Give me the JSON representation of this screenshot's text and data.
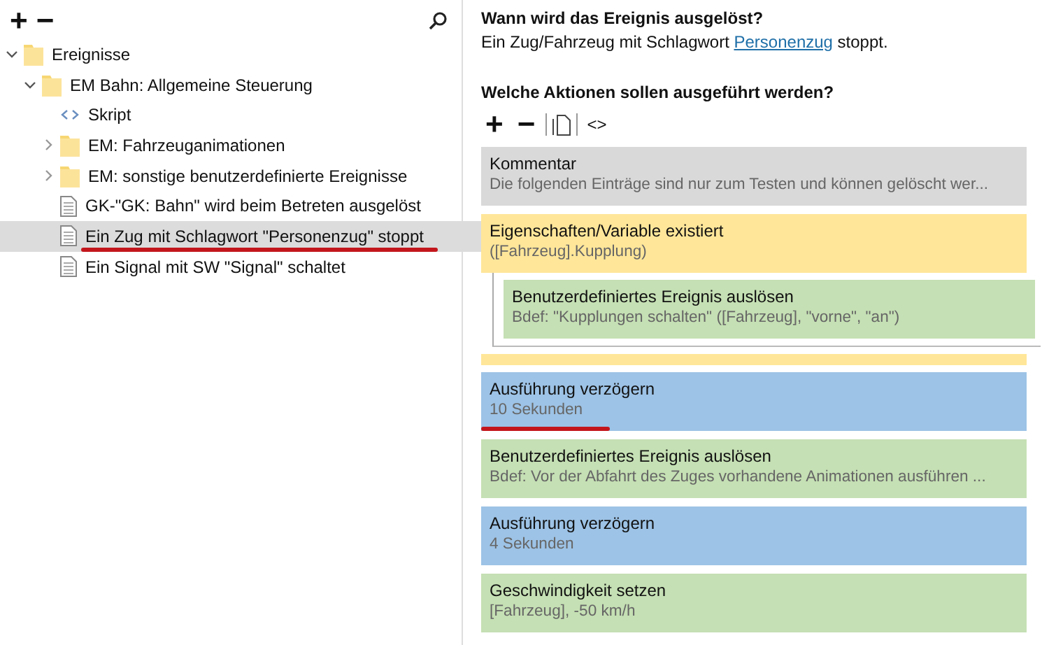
{
  "tree_toolbar": {
    "add": "+",
    "remove": "−"
  },
  "tree": [
    {
      "kind": "folder",
      "label": "Ereignisse",
      "expanded": true,
      "selected": false,
      "underlined": false,
      "children": [
        {
          "kind": "folder",
          "label": "EM Bahn: Allgemeine Steuerung",
          "expanded": true,
          "selected": false,
          "underlined": false,
          "children": [
            {
              "kind": "script",
              "label": "Skript",
              "selected": false,
              "underlined": false
            },
            {
              "kind": "folder",
              "label": "EM: Fahrzeuganimationen",
              "expanded": false,
              "selected": false,
              "underlined": false
            },
            {
              "kind": "folder",
              "label": "EM: sonstige benutzerdefinierte Ereignisse",
              "expanded": false,
              "selected": false,
              "underlined": false
            },
            {
              "kind": "document",
              "label": "GK-\"GK: Bahn\" wird beim Betreten ausgelöst",
              "selected": false,
              "underlined": false
            },
            {
              "kind": "document",
              "label": "Ein Zug mit Schlagwort \"Personenzug\" stoppt",
              "selected": true,
              "underlined": true
            },
            {
              "kind": "document",
              "label": "Ein Signal mit SW \"Signal\" schaltet",
              "selected": false,
              "underlined": false
            }
          ]
        }
      ]
    }
  ],
  "trigger": {
    "heading": "Wann wird das Ereignis ausgelöst?",
    "before": "Ein Zug/Fahrzeug mit Schlagwort",
    "link": "Personenzug",
    "after": "stoppt."
  },
  "actions_heading": "Welche Aktionen sollen ausgeführt werden?",
  "actions_toolbar": {
    "add": "+",
    "remove": "−",
    "script": "<>"
  },
  "actions": [
    {
      "title": "Kommentar",
      "detail": "Die folgenden Einträge sind nur zum Testen und können gelöscht wer...",
      "color": "#d9d9d9",
      "underlined": false
    },
    {
      "title": "Eigenschaften/Variable existiert",
      "detail": "([Fahrzeug].Kupplung)",
      "color": "#ffe699",
      "underlined": false,
      "children": [
        {
          "title": "Benutzerdefiniertes Ereignis auslösen",
          "detail": "Bdef: \"Kupplungen schalten\" ([Fahrzeug], \"vorne\", \"an\")",
          "color": "#c5e0b4",
          "underlined": false
        }
      ]
    },
    {
      "title": "Ausführung verzögern",
      "detail": "10 Sekunden",
      "color": "#9dc3e6",
      "underlined": true
    },
    {
      "title": "Benutzerdefiniertes Ereignis auslösen",
      "detail": "Bdef: Vor der Abfahrt des Zuges vorhandene Animationen ausführen ...",
      "color": "#c5e0b4",
      "underlined": false
    },
    {
      "title": "Ausführung verzögern",
      "detail": "4 Sekunden",
      "color": "#9dc3e6",
      "underlined": false
    },
    {
      "title": "Geschwindigkeit setzen",
      "detail": "[Fahrzeug], -50 km/h",
      "color": "#c5e0b4",
      "underlined": false
    }
  ]
}
